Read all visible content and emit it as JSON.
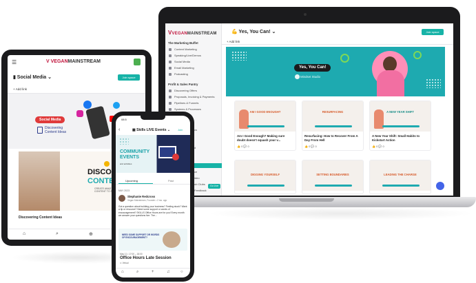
{
  "colors": {
    "brand_red": "#c0143c",
    "accent_teal": "#17b3a7",
    "banner_teal": "#1eaab0",
    "device_frame": "#1b1b1d",
    "fab_blue": "#4364e8"
  },
  "laptop": {
    "logo": {
      "v": "V",
      "brand": "VEGAN",
      "rest": "MAINSTREAM"
    },
    "sidebar": {
      "sections": [
        {
          "title": "The Marketing Buffet",
          "items": [
            "Content Marketing",
            "Speaking/Live/Demos",
            "Social Media",
            "Email Marketing",
            "Podcasting"
          ]
        },
        {
          "title": "Profit & Sales Pantry",
          "items": [
            "Discovering Offers",
            "Proposals, Invoicing & Payments",
            "Pipelines & Funnels",
            "Systems & Processes"
          ]
        }
      ],
      "partial_items": [
        "cs",
        "d",
        "ce",
        "ideo",
        "ub Clubs",
        "Feedback"
      ],
      "space_button": "Go Live"
    },
    "header": {
      "title_emoji": "💪",
      "title": "Yes, You Can!",
      "join_button": "Join space",
      "add_link": "+ Add link"
    },
    "banner": {
      "pill": "Yes, You Can!",
      "studio": "Mindset Studio"
    },
    "cards": [
      {
        "thumb": "AM I GOOD ENOUGH?",
        "title": "Am I Good Enough? Making sure doubt doesn't squash your v...",
        "meta": "👍 0   💬 0"
      },
      {
        "thumb": "RESURFACING",
        "title": "Resurfacing: How to Recover From A Day From Hell",
        "meta": "👍 0   💬 0"
      },
      {
        "thumb": "A NEW YEAR SHIFT",
        "title": "A New Year Shift: Small Habits to Kickstart Action",
        "meta": "👍 0   💬 0"
      },
      {
        "thumb": "DIGGING YOURSELF",
        "title": "",
        "meta": ""
      },
      {
        "thumb": "SETTING BOUNDARIES",
        "title": "",
        "meta": ""
      },
      {
        "thumb": "LEADING THE CHARGE",
        "title": "",
        "meta": ""
      }
    ]
  },
  "tablet": {
    "menu_icon": "☰",
    "logo": {
      "v": "V",
      "brand": "VEGAN",
      "rest": "MAINSTREAM"
    },
    "avatar_initials": "MR",
    "space_title": "Social Media",
    "join_button": "Join space",
    "add_link": "+ Add link",
    "hero": {
      "pill": "Social Media",
      "sub1": "Discovering",
      "sub2": "Content Ideas"
    },
    "feature": {
      "line1": "DISCOVER",
      "line2": "CONTENT I",
      "line3": "CREATE AMAZ",
      "line4": "CONTENT TO S"
    },
    "caption": "Discovering Content Ideas",
    "nav": [
      "⌂",
      "⌕",
      "⊕",
      "♫"
    ]
  },
  "phone": {
    "time": "08:5",
    "back": "‹",
    "title": "Skills LIVE Events",
    "join": "Join",
    "banner": {
      "line1": "COMMUNITY",
      "line2": "EVENTS",
      "line3": "and activities"
    },
    "tabs": [
      "Upcoming",
      "Past"
    ],
    "date_header": "MAY 2023",
    "author": "Stephanie Redcross",
    "author_meta": "Vegan Mainstream, Founder • 2 mo. ago",
    "post": "Got a question about building your business? Feeling stuck? Want a tip or resource? Need some support or words of encouragement? SKILLS Office Hours are for you! Every month we answer your questions live. The...",
    "card": {
      "line1": "NEED SOME SUPPORT OR WORDS",
      "line2": "OF ENCOURAGEMENT?"
    },
    "event": {
      "date": "May 11 • 17:00 – 18:00",
      "title": "Office Hours Late Session",
      "location": "Virtual"
    },
    "nav": [
      "⌂",
      "⌕",
      "+",
      "♫",
      "○"
    ]
  }
}
